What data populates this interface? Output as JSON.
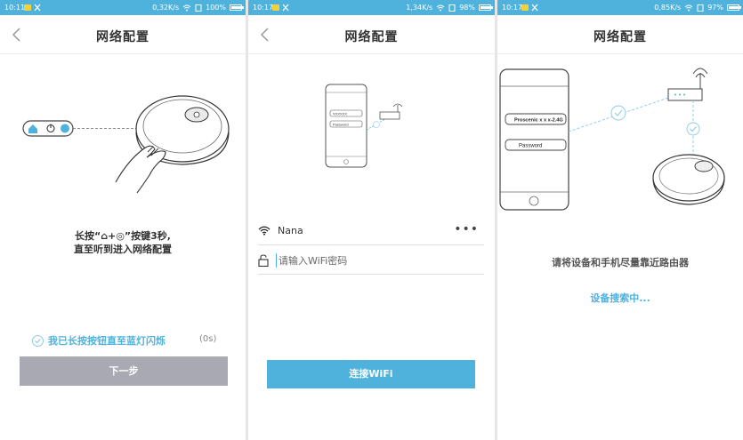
{
  "screens": [
    {
      "status": {
        "time": "10:11",
        "speed": "0,32K/s",
        "battery": "100%",
        "battery_level": 1.0
      },
      "title": "网络配置",
      "instruction": {
        "line1": "长按“⌂+◎”按键3秒,",
        "line2": "直至听到进入网络配置"
      },
      "confirm_label": "我已长按按钮直至蓝灯闪烁",
      "countdown": "(0s)",
      "next_button": "下一步"
    },
    {
      "status": {
        "time": "10:17",
        "speed": "1,34K/s",
        "battery": "98%",
        "battery_level": 0.98
      },
      "title": "网络配置",
      "illustration": {
        "field_ssid": "XXXXXX",
        "field_password": "Password"
      },
      "wifi_name": "Nana",
      "more_menu": "•••",
      "password_placeholder": "请输入WiFi密码",
      "connect_button": "连接WiFi"
    },
    {
      "status": {
        "time": "10:17",
        "speed": "0,85K/s",
        "battery": "97%",
        "battery_level": 0.97
      },
      "title": "网络配置",
      "illustration": {
        "field_ssid": "Proscenic x x x-2.4G",
        "field_password": "Password"
      },
      "hint": "请将设备和手机尽量靠近路由器",
      "searching": "设备搜索中..."
    }
  ],
  "colors": {
    "accent": "#4fb2dd",
    "button_disabled": "#a8a9b3",
    "status_bar": "#4fb2dd"
  }
}
